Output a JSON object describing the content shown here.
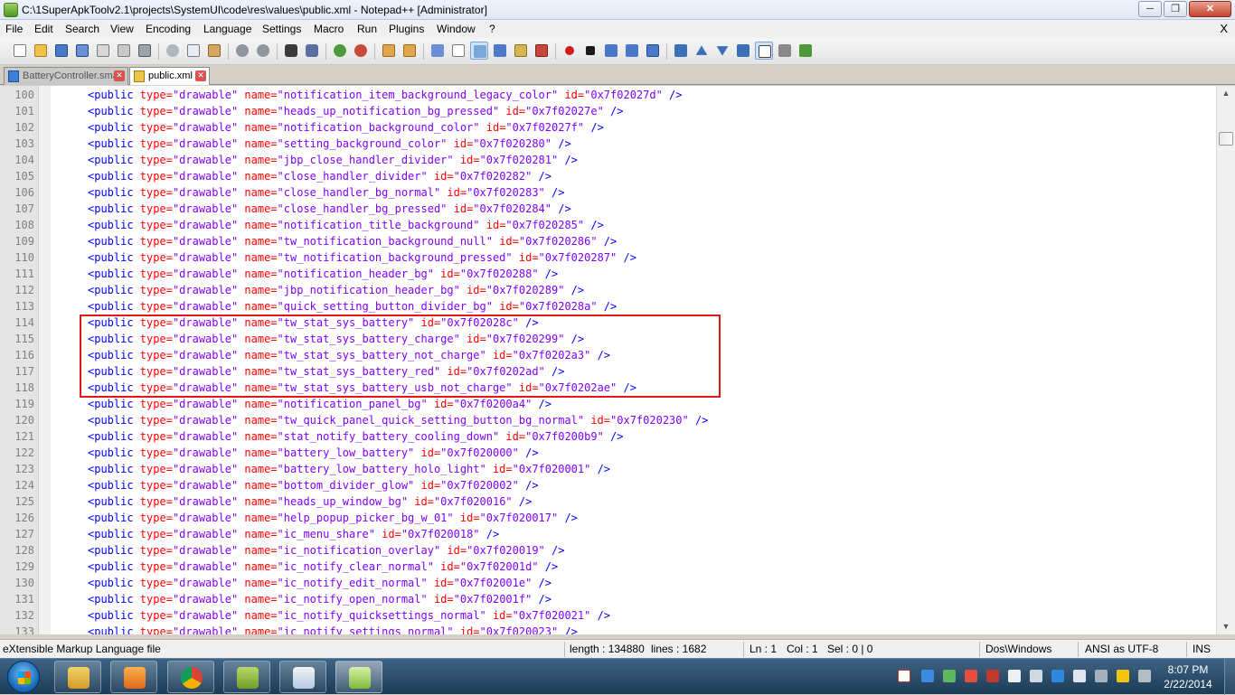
{
  "window": {
    "title": "C:\\1SuperApkToolv2.1\\projects\\SystemUI\\code\\res\\values\\public.xml - Notepad++ [Administrator]",
    "min_glyph": "─",
    "max_glyph": "❐",
    "close_glyph": "✕"
  },
  "menu": {
    "items": [
      "File",
      "Edit",
      "Search",
      "View",
      "Encoding",
      "Language",
      "Settings",
      "Macro",
      "Run",
      "Plugins",
      "Window",
      "?"
    ],
    "close_glyph": "X"
  },
  "tabs": [
    {
      "label": "BatteryController.smali",
      "close_glyph": "✕"
    },
    {
      "label": "public.xml",
      "close_glyph": "✕"
    }
  ],
  "editor": {
    "lines": [
      {
        "n": "100",
        "name": "notification_item_background_legacy_color",
        "id": "0x7f02027d"
      },
      {
        "n": "101",
        "name": "heads_up_notification_bg_pressed",
        "id": "0x7f02027e"
      },
      {
        "n": "102",
        "name": "notification_background_color",
        "id": "0x7f02027f"
      },
      {
        "n": "103",
        "name": "setting_background_color",
        "id": "0x7f020280"
      },
      {
        "n": "104",
        "name": "jbp_close_handler_divider",
        "id": "0x7f020281"
      },
      {
        "n": "105",
        "name": "close_handler_divider",
        "id": "0x7f020282"
      },
      {
        "n": "106",
        "name": "close_handler_bg_normal",
        "id": "0x7f020283"
      },
      {
        "n": "107",
        "name": "close_handler_bg_pressed",
        "id": "0x7f020284"
      },
      {
        "n": "108",
        "name": "notification_title_background",
        "id": "0x7f020285"
      },
      {
        "n": "109",
        "name": "tw_notification_background_null",
        "id": "0x7f020286"
      },
      {
        "n": "110",
        "name": "tw_notification_background_pressed",
        "id": "0x7f020287"
      },
      {
        "n": "111",
        "name": "notification_header_bg",
        "id": "0x7f020288"
      },
      {
        "n": "112",
        "name": "jbp_notification_header_bg",
        "id": "0x7f020289"
      },
      {
        "n": "113",
        "name": "quick_setting_button_divider_bg",
        "id": "0x7f02028a"
      },
      {
        "n": "114",
        "name": "tw_stat_sys_battery",
        "id": "0x7f02028c"
      },
      {
        "n": "115",
        "name": "tw_stat_sys_battery_charge",
        "id": "0x7f020299"
      },
      {
        "n": "116",
        "name": "tw_stat_sys_battery_not_charge",
        "id": "0x7f0202a3"
      },
      {
        "n": "117",
        "name": "tw_stat_sys_battery_red",
        "id": "0x7f0202ad"
      },
      {
        "n": "118",
        "name": "tw_stat_sys_battery_usb_not_charge",
        "id": "0x7f0202ae"
      },
      {
        "n": "119",
        "name": "notification_panel_bg",
        "id": "0x7f0200a4"
      },
      {
        "n": "120",
        "name": "tw_quick_panel_quick_setting_button_bg_normal",
        "id": "0x7f020230"
      },
      {
        "n": "121",
        "name": "stat_notify_battery_cooling_down",
        "id": "0x7f0200b9"
      },
      {
        "n": "122",
        "name": "battery_low_battery",
        "id": "0x7f020000"
      },
      {
        "n": "123",
        "name": "battery_low_battery_holo_light",
        "id": "0x7f020001"
      },
      {
        "n": "124",
        "name": "bottom_divider_glow",
        "id": "0x7f020002"
      },
      {
        "n": "125",
        "name": "heads_up_window_bg",
        "id": "0x7f020016"
      },
      {
        "n": "126",
        "name": "help_popup_picker_bg_w_01",
        "id": "0x7f020017"
      },
      {
        "n": "127",
        "name": "ic_menu_share",
        "id": "0x7f020018"
      },
      {
        "n": "128",
        "name": "ic_notification_overlay",
        "id": "0x7f020019"
      },
      {
        "n": "129",
        "name": "ic_notify_clear_normal",
        "id": "0x7f02001d"
      },
      {
        "n": "130",
        "name": "ic_notify_edit_normal",
        "id": "0x7f02001e"
      },
      {
        "n": "131",
        "name": "ic_notify_open_normal",
        "id": "0x7f02001f"
      },
      {
        "n": "132",
        "name": "ic_notify_quicksettings_normal",
        "id": "0x7f020021"
      },
      {
        "n": "133",
        "name": "ic_notify_settings_normal",
        "id": "0x7f020023"
      }
    ],
    "tag_open": "<public",
    "type_attr": " type=",
    "type_value": "\"drawable\"",
    "name_attr": " name=",
    "id_attr": " id=",
    "tag_close": " />",
    "highlight_color": "#e01818"
  },
  "statusbar": {
    "file_type": "eXtensible Markup Language file",
    "length": "length : 134880",
    "lines": "lines : 1682",
    "ln": "Ln : 1",
    "col": "Col : 1",
    "sel": "Sel : 0 | 0",
    "eol": "Dos\\Windows",
    "encoding": "ANSI as UTF-8",
    "mode": "INS"
  },
  "taskbar": {
    "time": "8:07 PM",
    "date": "2/22/2014",
    "apps": [
      "explorer-icon",
      "media-player-icon",
      "chrome-icon",
      "android-apk-icon",
      "paint-icon",
      "notepad-plus-plus-icon"
    ]
  }
}
